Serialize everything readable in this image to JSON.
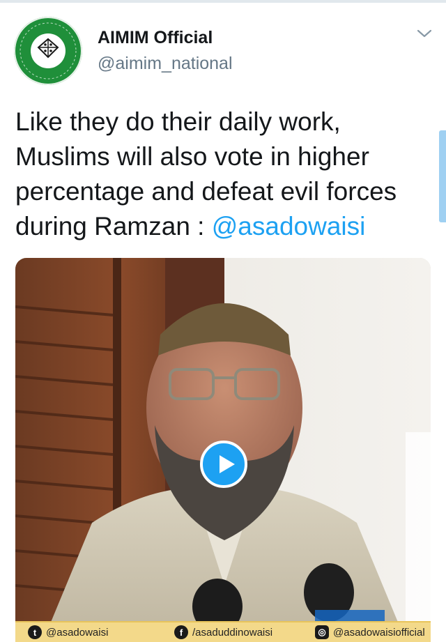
{
  "tweet": {
    "display_name": "AIMIM Official",
    "handle": "@aimim_national",
    "text": "Like they do their daily work, Muslims will also vote in higher percentage and defeat evil forces during Ramzan : ",
    "mention": "@asadowaisi"
  },
  "video_footer": {
    "twitter_handle": "@asadowaisi",
    "facebook_handle": "/asaduddinowaisi",
    "instagram_handle": "@asadowaisiofficial"
  },
  "colors": {
    "accent": "#1da1f2",
    "avatar_green": "#1f8f3a",
    "footer_band": "#f3d98a"
  },
  "icons": {
    "play": "play-icon",
    "chevron": "chevron-down-icon",
    "twitter": "twitter-icon",
    "facebook": "facebook-icon",
    "instagram": "instagram-icon"
  }
}
